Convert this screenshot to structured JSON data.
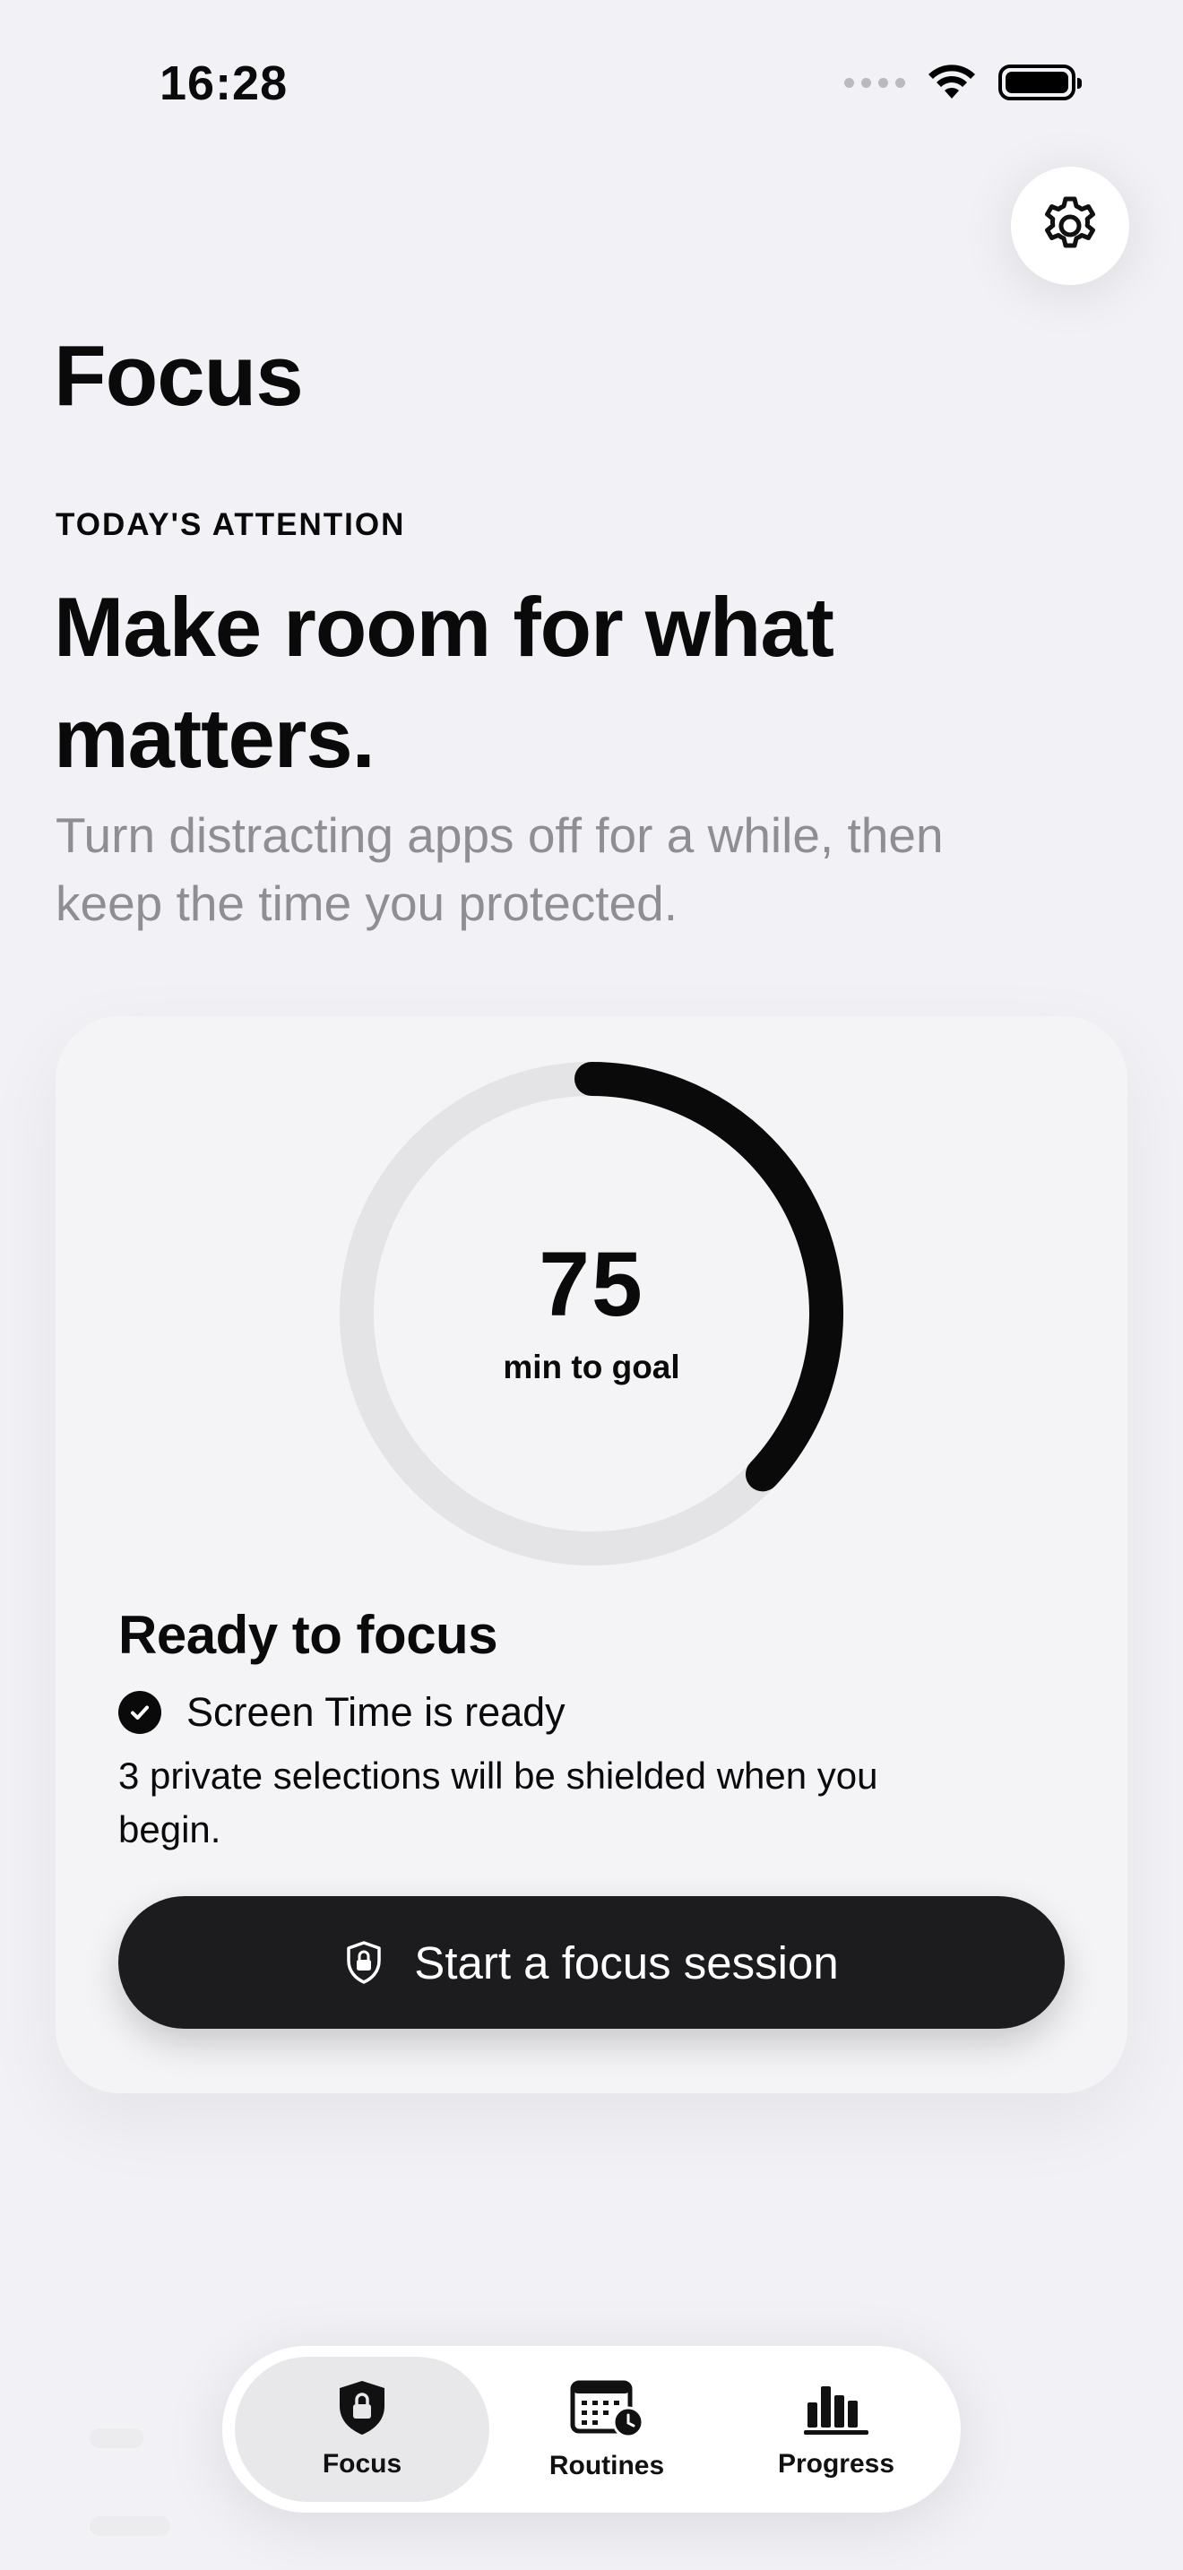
{
  "status_bar": {
    "time": "16:28"
  },
  "header": {
    "title": "Focus",
    "settings_icon": "gear-icon"
  },
  "hero": {
    "eyebrow": "TODAY'S ATTENTION",
    "headline": "Make room for what matters.",
    "subtitle": "Turn distracting apps off for a while, then keep the time you protected."
  },
  "goal_ring": {
    "value": "75",
    "caption": "min to goal",
    "progress_fraction": 0.37
  },
  "readiness": {
    "heading": "Ready to focus",
    "check_label": "Screen Time is ready",
    "note": "3 private selections will be shielded when you begin."
  },
  "primary_action": {
    "label": "Start a focus session",
    "icon": "shield-lock-icon"
  },
  "tabs": [
    {
      "label": "Focus",
      "icon": "shield-lock-icon",
      "active": true
    },
    {
      "label": "Routines",
      "icon": "calendar-clock-icon",
      "active": false
    },
    {
      "label": "Progress",
      "icon": "bar-chart-icon",
      "active": false
    }
  ],
  "colors": {
    "background": "#f2f2f6",
    "accent": "#0a0a0a",
    "muted_text": "#8e8e93",
    "button": "#1c1c1e"
  }
}
